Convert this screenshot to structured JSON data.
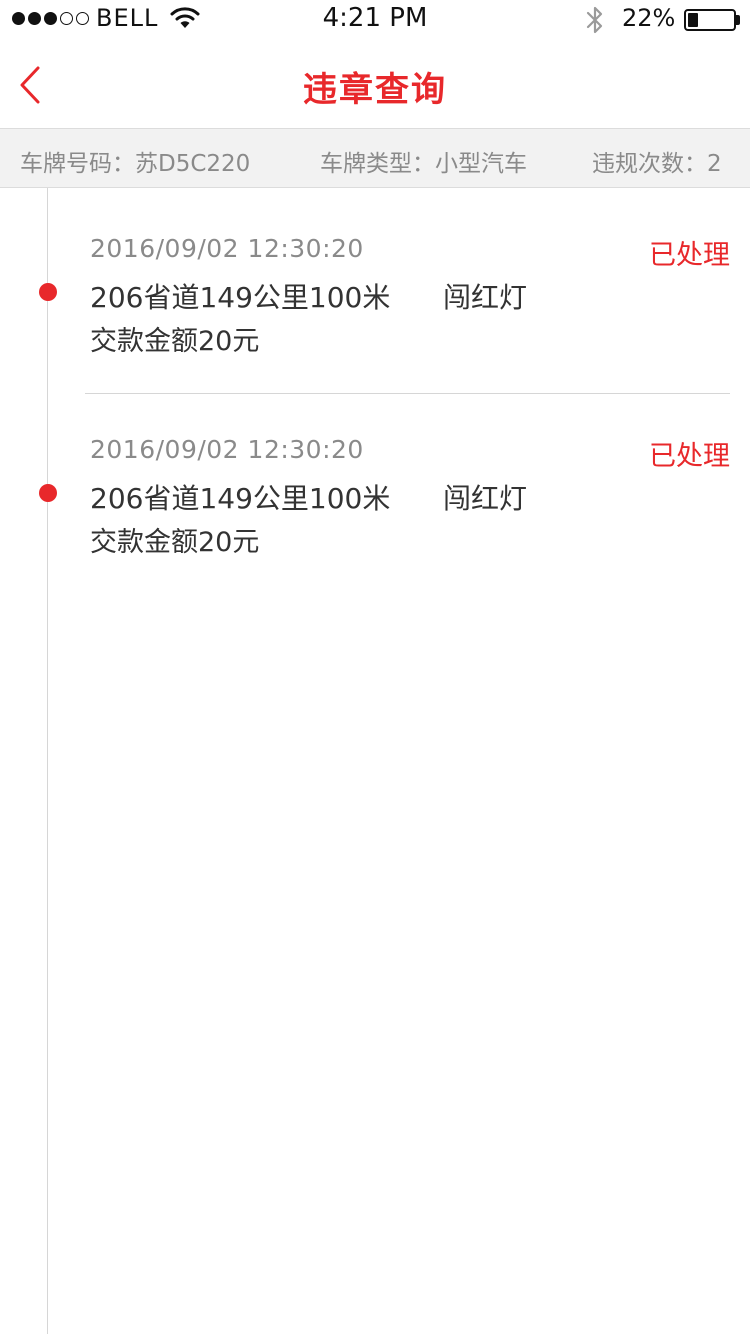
{
  "status_bar": {
    "carrier": "BELL",
    "time": "4:21 PM",
    "battery": "22%",
    "battery_level": 0.22,
    "signal_strength": 3,
    "signal_total": 5,
    "icons": [
      "wifi-icon",
      "bluetooth-icon",
      "battery-icon"
    ]
  },
  "nav": {
    "title": "违章查询",
    "back_icon": "chevron-left-icon"
  },
  "info": {
    "plate": "车牌号码：苏D5C220",
    "vehicle_type": "车牌类型：小型汽车",
    "violation_count": "违规次数：2"
  },
  "records": [
    {
      "time": "2016/09/02  12:30:20",
      "status": "已处理",
      "location": "206省道149公里100米",
      "type": "闯红灯",
      "fine": "交款金额20元"
    },
    {
      "time": "2016/09/02  12:30:20",
      "status": "已处理",
      "location": "206省道149公里100米",
      "type": "闯红灯",
      "fine": "交款金额20元"
    }
  ],
  "colors": {
    "accent": "#e8282b",
    "muted_text": "#8a8a8a",
    "body_text": "#333333",
    "info_bar_bg": "#f2f2f2",
    "line": "#d6d6d6"
  }
}
